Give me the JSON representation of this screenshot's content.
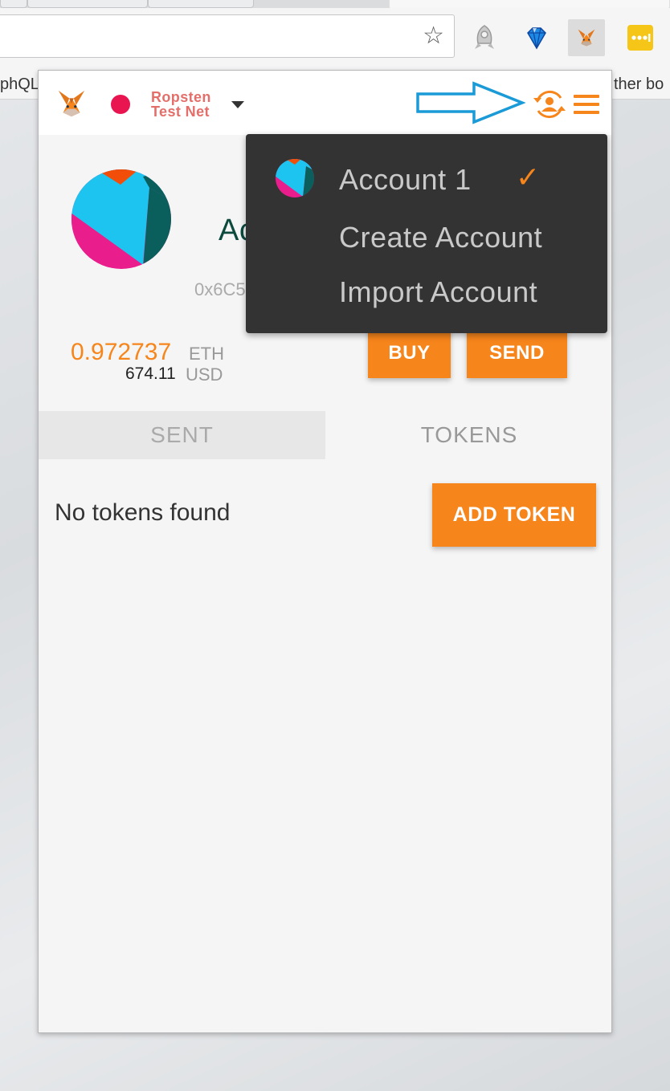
{
  "browser": {
    "bookmarks_left": "phQL",
    "bookmarks_right": "ther bo",
    "star_glyph": "☆"
  },
  "header": {
    "network_line1": "Ropsten",
    "network_line2": "Test Net",
    "network_dot_color": "#e91550",
    "accent_color": "#f6851b"
  },
  "account": {
    "name": "Account 1",
    "address": "0x6C5e0...",
    "more_glyph": "•••",
    "eth_amount": "0.972737",
    "eth_unit": "ETH",
    "usd_amount": "674.11",
    "usd_unit": "USD"
  },
  "actions": {
    "buy_label": "BUY",
    "send_label": "SEND"
  },
  "tabs": [
    {
      "label": "SENT",
      "active": false
    },
    {
      "label": "TOKENS",
      "active": true
    }
  ],
  "tokens": {
    "empty_text": "No tokens found",
    "add_label": "ADD TOKEN"
  },
  "dropdown": {
    "items": [
      {
        "label": "Account 1",
        "selected": true
      },
      {
        "label": "Create Account"
      },
      {
        "label": "Import Account"
      }
    ],
    "check_glyph": "✓"
  },
  "icons": [
    "metamask-fox-icon",
    "account-switch-icon",
    "hamburger-menu-icon",
    "blue-arrow-callout-icon",
    "star-icon"
  ]
}
